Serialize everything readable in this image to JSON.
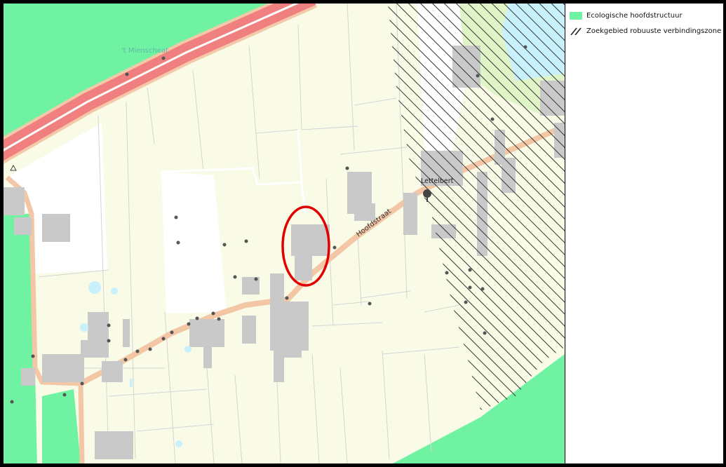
{
  "map": {
    "labels": {
      "place_mienscheard": "'t Mienscheat",
      "place_lettelbert": "Lettelbert",
      "road_hoofdstraat": "Hoofdstraat"
    },
    "colors": {
      "ecological": "#6ff3a2",
      "field": "#f9fbe7",
      "building": "#c9c9c9",
      "motorway": "#f08080",
      "road": "#f3c7a5",
      "water": "#c8f1fb",
      "highlight": "#e00000",
      "hatch": "#333333"
    }
  },
  "legend": {
    "items": [
      {
        "label": "Ecologische hoofdstructuur",
        "symbol": "green-fill"
      },
      {
        "label": "Zoekgebied robuuste verbindingszone",
        "symbol": "diagonal-hatch"
      }
    ]
  }
}
